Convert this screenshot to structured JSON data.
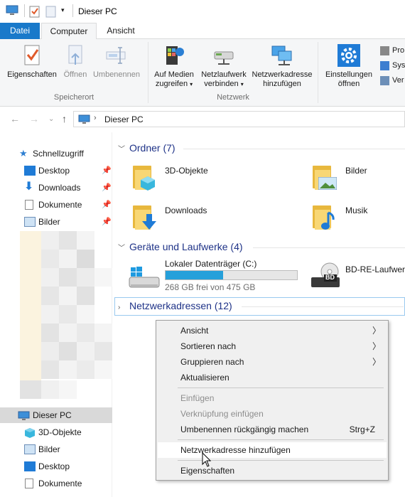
{
  "window": {
    "title": "Dieser PC"
  },
  "ribbon_tabs": [
    "Datei",
    "Computer",
    "Ansicht"
  ],
  "ribbon": {
    "location_group": {
      "label": "Speicherort",
      "buttons": [
        "Eigenschaften",
        "Öffnen",
        "Umbenennen"
      ]
    },
    "network_group": {
      "label": "Netzwerk",
      "media_line1": "Auf Medien",
      "media_line2": "zugreifen",
      "drive_line1": "Netzlaufwerk",
      "drive_line2": "verbinden",
      "netaddr_line1": "Netzwerkadresse",
      "netaddr_line2": "hinzufügen"
    },
    "settings_line1": "Einstellungen",
    "settings_line2": "öffnen",
    "system_items": [
      "Pro",
      "Syst",
      "Ver"
    ]
  },
  "address": {
    "path": "Dieser PC"
  },
  "sidebar": {
    "quick_access": "Schnellzugriff",
    "pinned": [
      "Desktop",
      "Downloads",
      "Dokumente",
      "Bilder"
    ],
    "this_pc": "Dieser PC",
    "this_pc_items": [
      "3D-Objekte",
      "Bilder",
      "Desktop",
      "Dokumente"
    ]
  },
  "content": {
    "folders_header": "Ordner (7)",
    "folders": [
      "3D-Objekte",
      "Bilder",
      "Downloads",
      "Musik"
    ],
    "devices_header": "Geräte und Laufwerke (4)",
    "drive": {
      "name": "Lokaler Datenträger (C:)",
      "free_text": "268 GB frei von 475 GB",
      "used_fraction": 0.436
    },
    "bd_drive": "BD-RE-Laufwerk",
    "network_header": "Netzwerkadressen (12)"
  },
  "context_menu": {
    "items": [
      "Ansicht",
      "Sortieren nach",
      "Gruppieren nach",
      "Aktualisieren",
      "Einfügen",
      "Verknüpfung einfügen",
      "Umbenennen rückgängig machen",
      "Netzwerkadresse hinzufügen",
      "Eigenschaften"
    ],
    "undo_shortcut": "Strg+Z"
  },
  "colors": {
    "accent": "#1979ca",
    "header_text": "#1e3287",
    "folder_yellow": "#f8d775",
    "drive_bar": "#26a0da"
  }
}
